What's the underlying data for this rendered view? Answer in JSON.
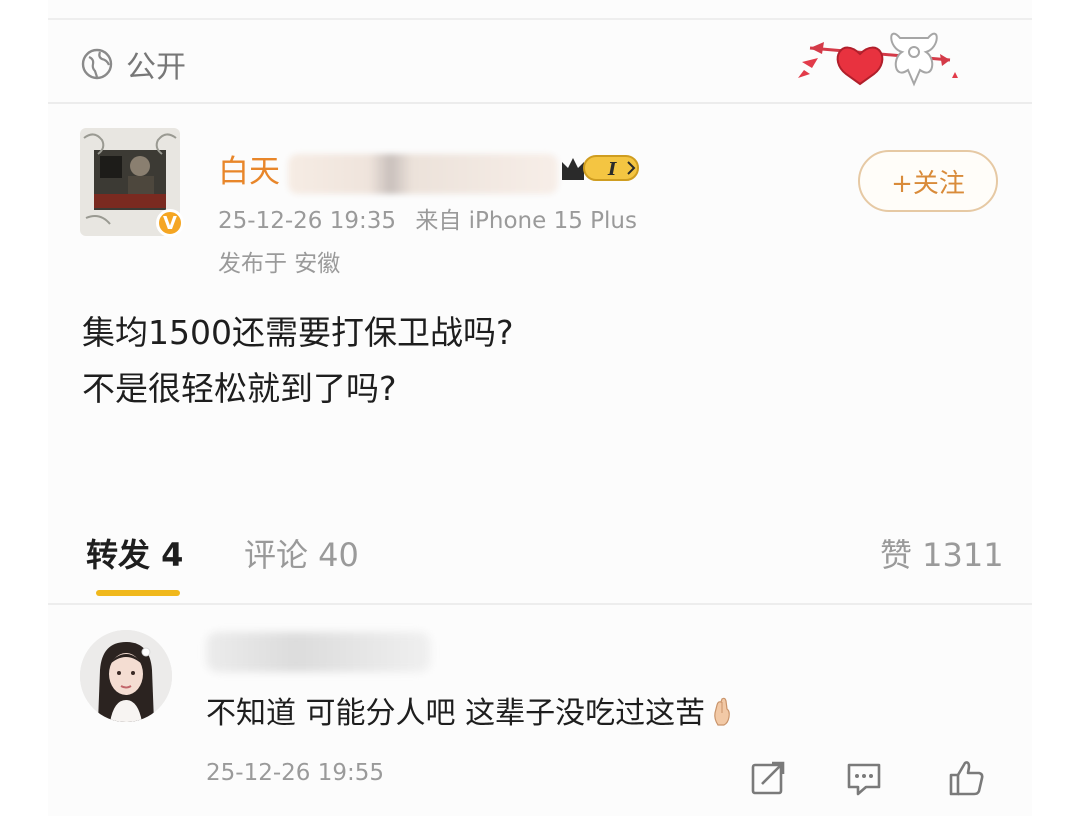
{
  "visibility": {
    "icon": "globe-icon",
    "label": "公开"
  },
  "post": {
    "author": {
      "name_visible": "白天",
      "level_label": "I",
      "verified": true
    },
    "follow_label": "+关注",
    "timestamp": "25-12-26 19:35",
    "source": "来自 iPhone 15 Plus",
    "location": "发布于 安徽",
    "body_lines": [
      "集均1500还需要打保卫战吗?",
      "不是很轻松就到了吗?"
    ]
  },
  "tabs": {
    "repost": "转发 4",
    "comments": "评论 40",
    "likes": "赞 1311"
  },
  "comment": {
    "text": "不知道 可能分人吧 这辈子没吃过这苦",
    "timestamp": "25-12-26 19:55",
    "actions": [
      "share-icon",
      "reply-icon",
      "like-icon"
    ]
  },
  "colors": {
    "accent_orange": "#e8862a",
    "tab_indicator": "#f0b81c",
    "muted_text": "#9a9a9a",
    "follow_border": "#e6c9a4"
  }
}
